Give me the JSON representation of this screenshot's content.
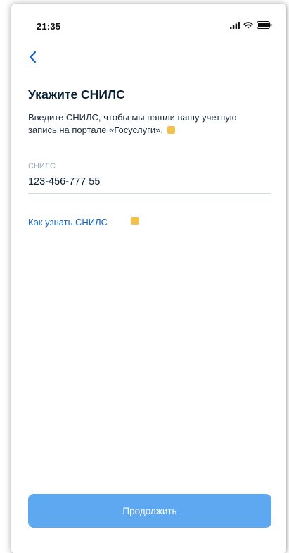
{
  "status_bar": {
    "time": "21:35",
    "icons": [
      "signal-icon",
      "wifi-icon",
      "battery-icon"
    ]
  },
  "header": {
    "back_icon": "chevron-left-icon"
  },
  "main": {
    "title": "Укажите СНИЛС",
    "description": "Введите СНИЛС, чтобы мы нашли вашу учетную запись на портале «Госуслуги».",
    "field": {
      "label": "СНИЛС",
      "value": "123-456-777 55"
    },
    "help_link": "Как узнать СНИЛС",
    "continue_label": "Продолжить"
  },
  "colors": {
    "accent": "#0d64c8",
    "button": "#5ea8f2",
    "marker": "#f2c14e",
    "title": "#0b1f33"
  }
}
